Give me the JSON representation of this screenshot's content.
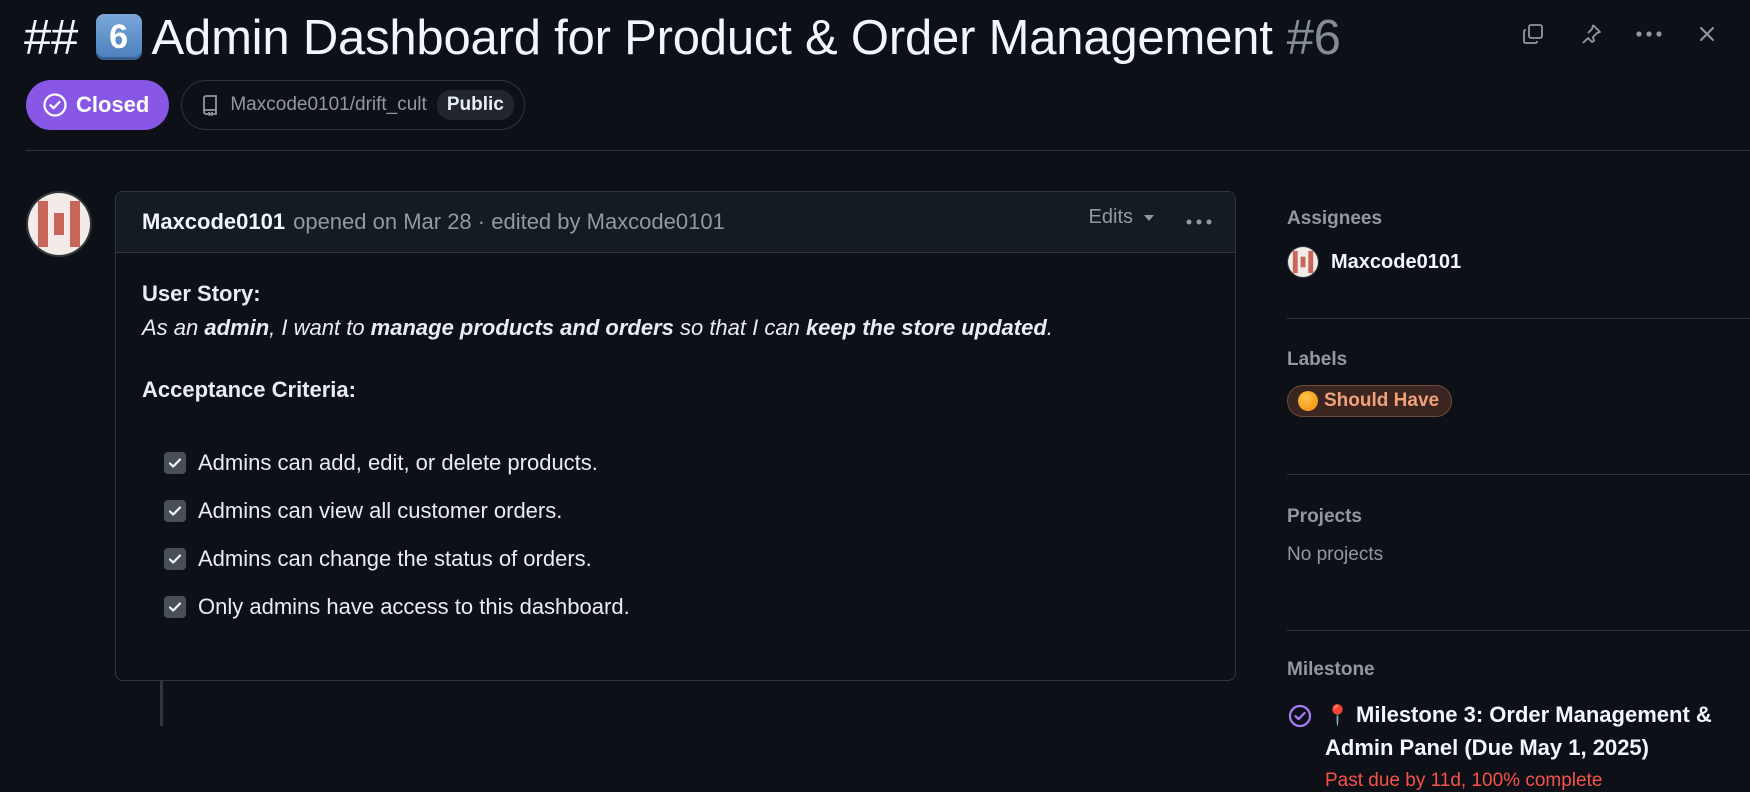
{
  "issue": {
    "title_prefix": "##",
    "keycap_number": "6",
    "title": "Admin Dashboard for Product & Order Management",
    "number": "#6",
    "state_label": "Closed",
    "repo": "Maxcode0101/drift_cult",
    "visibility": "Public"
  },
  "colors": {
    "closed": "#8957e5",
    "past_due": "#f85149",
    "label_text": "#f2a07a"
  },
  "top_actions": [
    "copy-icon",
    "pin-icon",
    "more-icon",
    "close-icon"
  ],
  "comment": {
    "author": "Maxcode0101",
    "meta": "opened on Mar 28 · edited by Maxcode0101",
    "edits_label": "Edits",
    "user_story_heading": "User Story:",
    "story": {
      "p1": "As an ",
      "b1": "admin",
      "p2": ", I want to ",
      "b2": "manage products and orders",
      "p3": " so that I can ",
      "b3": "keep the store updated",
      "p4": "."
    },
    "acceptance_heading": "Acceptance Criteria:",
    "criteria": [
      {
        "text": "Admins can add, edit, or delete products.",
        "checked": true
      },
      {
        "text": "Admins can view all customer orders.",
        "checked": true
      },
      {
        "text": "Admins can change the status of orders.",
        "checked": true
      },
      {
        "text": "Only admins have access to this dashboard.",
        "checked": true
      }
    ]
  },
  "sidebar": {
    "assignees_title": "Assignees",
    "assignee": "Maxcode0101",
    "labels_title": "Labels",
    "label": "Should Have",
    "projects_title": "Projects",
    "projects_value": "No projects",
    "milestone_title": "Milestone",
    "milestone": "Milestone 3: Order Management & Admin Panel (Due May 1, 2025)",
    "milestone_status": "Past due by 11d, 100% complete"
  }
}
